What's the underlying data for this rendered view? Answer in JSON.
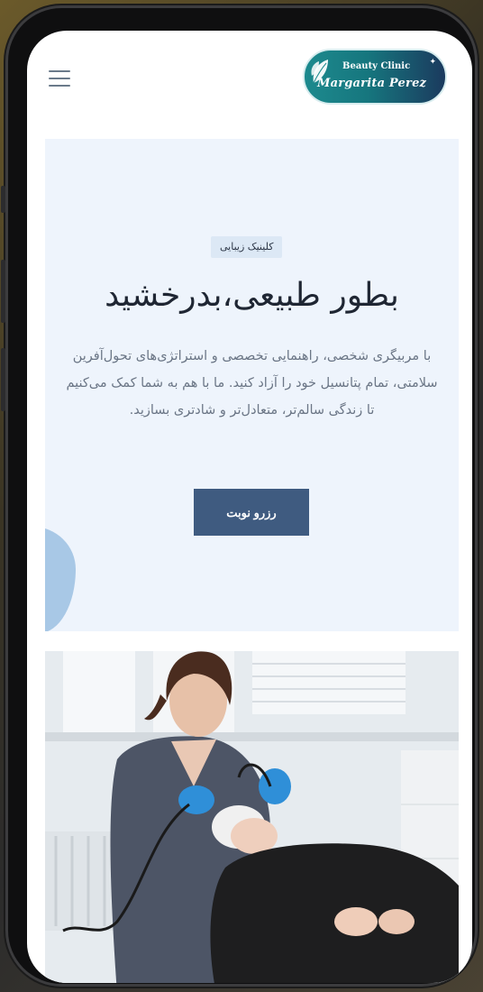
{
  "logo": {
    "line1": "Beauty Clinic",
    "line2": "Margarita Perez",
    "colors": {
      "teal": "#1d8a8e",
      "navy": "#1b3a5e"
    }
  },
  "header": {
    "menu_icon": "hamburger-menu-icon"
  },
  "hero": {
    "badge": "کلینیک زیبایی",
    "title": "بطور طبیعی،بدرخشید",
    "description": "با مربیگری شخصی، راهنمایی تخصصی و استراتژی‌های تحول‌آفرین سلامتی، تمام پتانسیل خود را آزاد کنید. ما با هم به شما کمک می‌کنیم تا زندگی سالم‌تر، متعادل‌تر و شادتری بسازید.",
    "cta": "رزرو نوبت",
    "colors": {
      "background": "#eef4fc",
      "button": "#3f5b80",
      "accent_blob": "#a8c8e6"
    }
  },
  "photo": {
    "subject": "aesthetician performing facial treatment on client in clinic"
  }
}
